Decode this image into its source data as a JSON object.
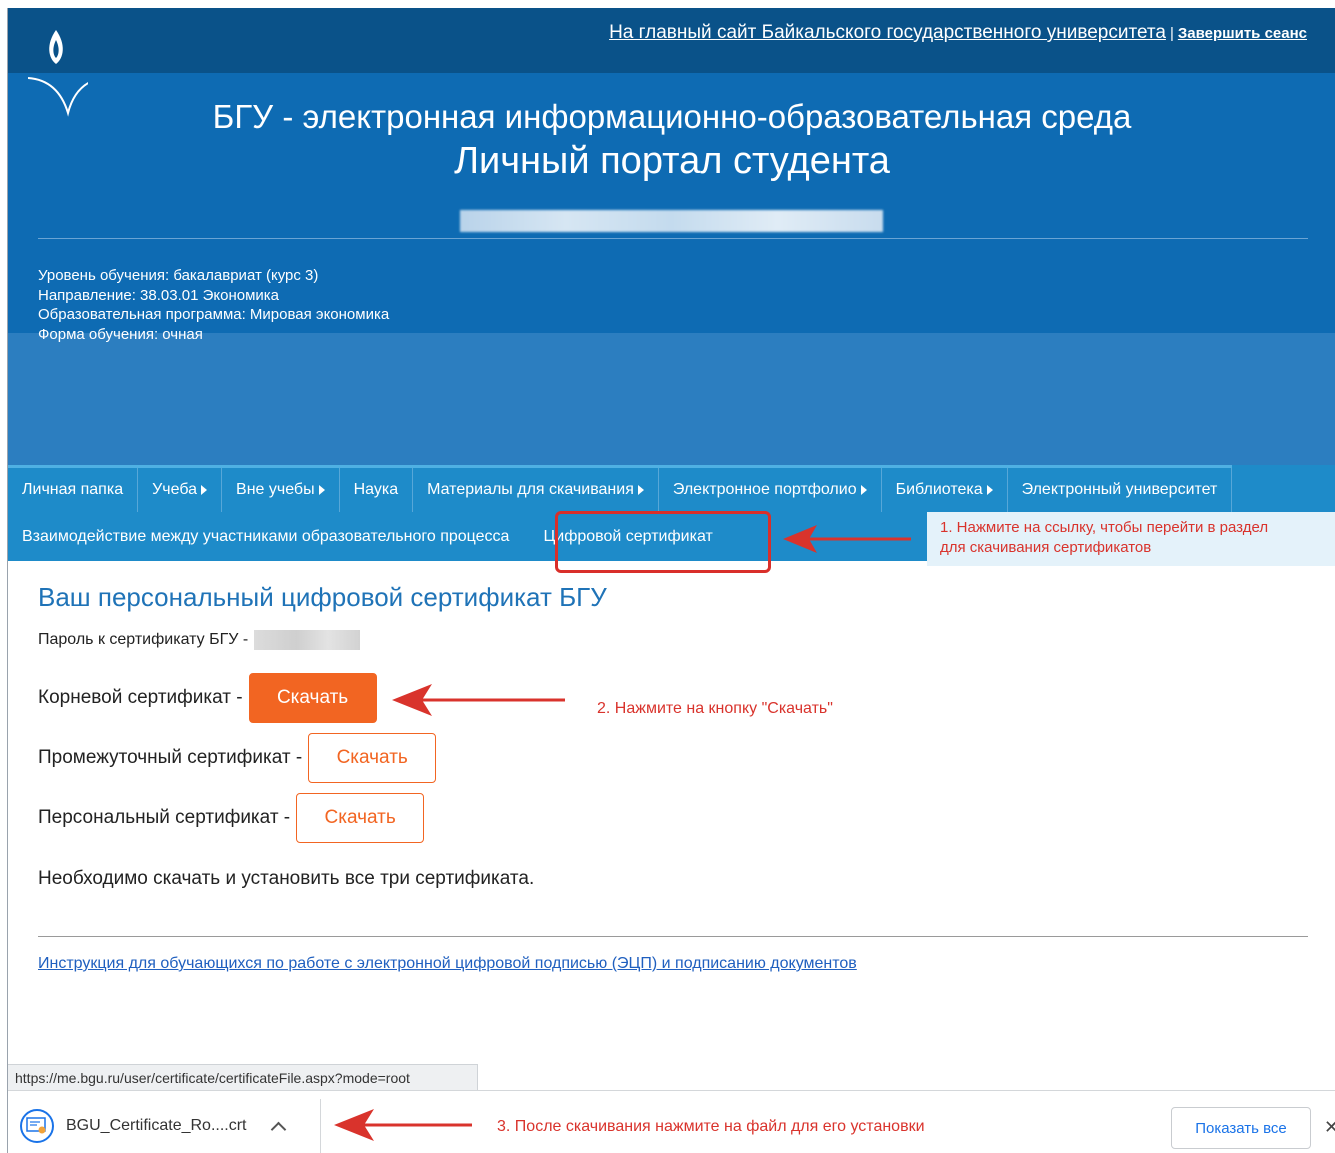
{
  "header": {
    "main_site_link": "На главный сайт Байкальского государственного университета",
    "separator": "|",
    "logout_link": "Завершить сеанс",
    "title_line1": "БГУ - электронная информационно-образовательная среда",
    "title_line2": "Личный портал студента"
  },
  "student_info": [
    "Уровень обучения: бакалавриат (курс 3)",
    "Направление: 38.03.01 Экономика",
    "Образовательная программа: Мировая экономика",
    "Форма обучения: очная"
  ],
  "nav": {
    "row1": [
      {
        "label": "Личная папка",
        "submenu": false
      },
      {
        "label": "Учеба",
        "submenu": true
      },
      {
        "label": "Вне учебы",
        "submenu": true
      },
      {
        "label": "Наука",
        "submenu": false
      },
      {
        "label": "Материалы для скачивания",
        "submenu": true
      },
      {
        "label": "Электронное портфолио",
        "submenu": true
      },
      {
        "label": "Библиотека",
        "submenu": true
      },
      {
        "label": "Электронный университет",
        "submenu": false
      }
    ],
    "row2": [
      {
        "label": "Взаимодействие между участниками образовательного процесса"
      },
      {
        "label": "Цифровой сертификат"
      }
    ]
  },
  "content": {
    "title": "Ваш персональный цифровой сертификат БГУ",
    "password_label": "Пароль к сертификату БГУ -",
    "certificates": [
      {
        "label": "Корневой сертификат -",
        "button": "Скачать"
      },
      {
        "label": "Промежуточный сертификат -",
        "button": "Скачать"
      },
      {
        "label": "Персональный сертификат -",
        "button": "Скачать"
      }
    ],
    "note": "Необходимо скачать и установить все три сертификата.",
    "instruction_link": "Инструкция для обучающихся по работе с электронной цифровой подписью (ЭЦП) и подписанию документов"
  },
  "annotations": {
    "step1_line1": "1. Нажмите на ссылку, чтобы перейти в раздел",
    "step1_line2": "для скачивания сертификатов",
    "step2": "2. Нажмите на кнопку \"Скачать\"",
    "step3": "3. После скачивания нажмите на файл для его установки"
  },
  "status_bar": {
    "url": "https://me.bgu.ru/user/certificate/certificateFile.aspx?mode=root"
  },
  "download_bar": {
    "file_name": "BGU_Certificate_Ro....crt",
    "show_all": "Показать все",
    "close": "✕"
  },
  "colors": {
    "header_dark": "#0a5289",
    "header": "#0e6bb3",
    "nav": "#1e8bc9",
    "accent_orange": "#f26522",
    "annotation_red": "#d9332c",
    "title_blue": "#1f73b7"
  }
}
